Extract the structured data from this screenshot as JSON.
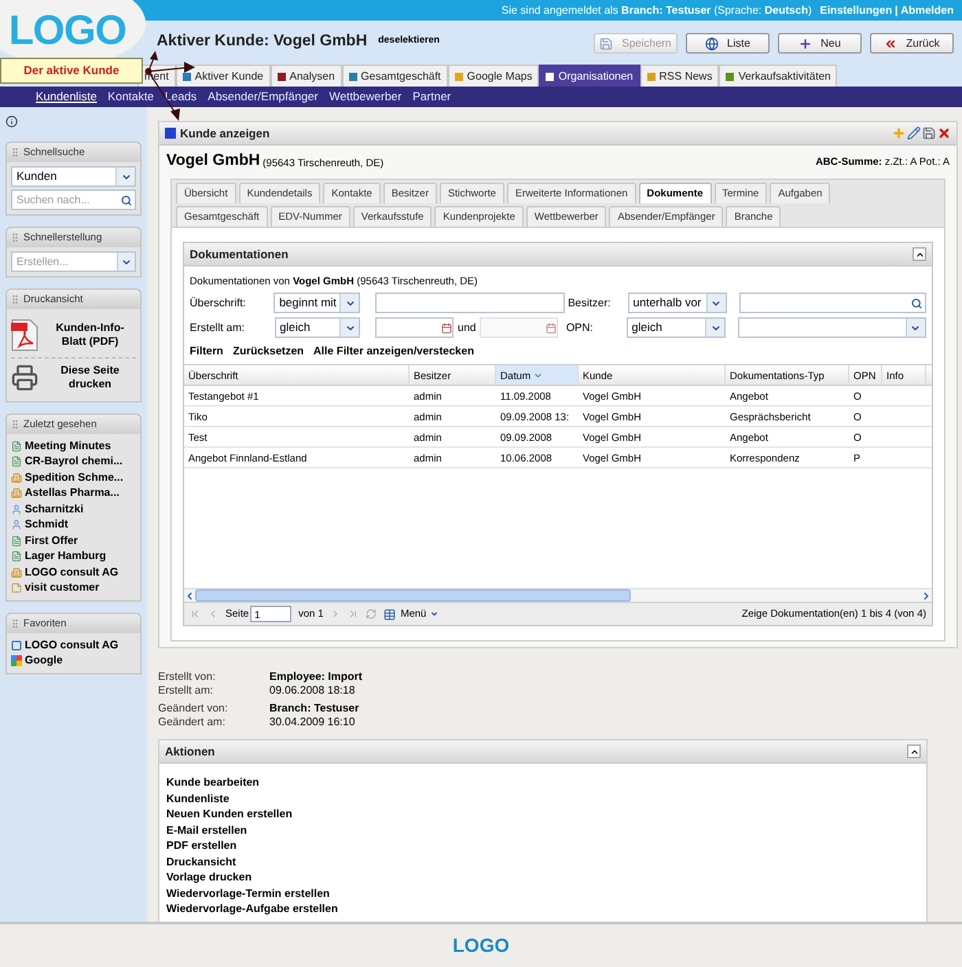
{
  "top_bar": {
    "login": "Sie sind angemeldet als **Branch: Testuser** (Sprache: **Deutsch**)",
    "links": [
      "Einstellungen",
      "Abmelden"
    ],
    "link_separator": "|"
  },
  "logo": "LOGO",
  "active_customer": {
    "title": "Aktiver Kunde: Vogel GmbH",
    "deselect": "deselektieren"
  },
  "toolbar_buttons": [
    {
      "label": "Speichern",
      "kind": "save",
      "disabled": true
    },
    {
      "label": "Liste",
      "kind": "list",
      "disabled": false
    },
    {
      "label": "Neu",
      "kind": "new",
      "disabled": false
    },
    {
      "label": "Zurück",
      "kind": "back",
      "disabled": false
    }
  ],
  "callout": {
    "text": "Der aktive Kunde"
  },
  "main_tabs": [
    {
      "label": "ment",
      "selected": false
    },
    {
      "label": "Aktiver Kunde",
      "color": "#2e7cb8",
      "selected": false
    },
    {
      "label": "Analysen",
      "color": "#8c1c24",
      "selected": false
    },
    {
      "label": "Gesamtgeschäft",
      "color": "#2a7fa8",
      "selected": false
    },
    {
      "label": "Google Maps",
      "color": "#e0a81c",
      "selected": false
    },
    {
      "label": "Organisationen",
      "color": "#ffffff",
      "selected": true
    },
    {
      "label": "RSS News",
      "color": "#d9a21a",
      "selected": false
    },
    {
      "label": "Verkaufsaktivitäten",
      "color": "#5f8f1e",
      "selected": false
    }
  ],
  "sub_nav": [
    {
      "label": "Kundenliste",
      "selected": true
    },
    {
      "label": "Kontakte",
      "selected": false
    },
    {
      "label": "Leads",
      "selected": false
    },
    {
      "label": "Absender/Empfänger",
      "selected": false
    },
    {
      "label": "Wettbewerber",
      "selected": false
    },
    {
      "label": "Partner",
      "selected": false
    }
  ],
  "sidebar": {
    "quick_search": {
      "title": "Schnellsuche",
      "type_value": "Kunden",
      "placeholder": "Suchen nach..."
    },
    "quick_create": {
      "title": "Schnellerstellung",
      "placeholder": "Erstellen..."
    },
    "print_view": {
      "title": "Druckansicht",
      "items": [
        {
          "label": "Kunden-Info-Blatt (PDF)",
          "kind": "pdf"
        },
        {
          "label": "Diese Seite drucken",
          "kind": "print"
        }
      ]
    },
    "recent": {
      "title": "Zuletzt gesehen",
      "items": [
        {
          "label": "Meeting Minutes",
          "kind": "document"
        },
        {
          "label": "CR-Bayrol chemi...",
          "kind": "document"
        },
        {
          "label": "Spedition Schme...",
          "kind": "organisation"
        },
        {
          "label": "Astellas Pharma...",
          "kind": "organisation"
        },
        {
          "label": "Scharnitzki",
          "kind": "person"
        },
        {
          "label": "Schmidt",
          "kind": "person"
        },
        {
          "label": "First Offer",
          "kind": "document"
        },
        {
          "label": "Lager Hamburg",
          "kind": "document"
        },
        {
          "label": "LOGO consult AG",
          "kind": "organisation"
        },
        {
          "label": "visit customer",
          "kind": "note"
        }
      ]
    },
    "favorites": {
      "title": "Favoriten",
      "items": [
        {
          "label": "LOGO consult AG",
          "kind": "link"
        },
        {
          "label": "Google",
          "kind": "web"
        }
      ]
    }
  },
  "customer_panel": {
    "title": "Kunde anzeigen",
    "name": "Vogel GmbH",
    "location": "(95643 Tirschenreuth, DE)",
    "abc": "**ABC-Summe:** z.Zt.: A Pot.: A",
    "tab_rows": [
      [
        {
          "label": "Übersicht",
          "selected": false
        },
        {
          "label": "Kundendetails",
          "selected": false
        },
        {
          "label": "Kontakte",
          "selected": false
        },
        {
          "label": "Besitzer",
          "selected": false
        },
        {
          "label": "Stichworte",
          "selected": false
        },
        {
          "label": "Erweiterte Informationen",
          "selected": false
        },
        {
          "label": "Dokumente",
          "selected": true
        },
        {
          "label": "Termine",
          "selected": false
        },
        {
          "label": "Aufgaben",
          "selected": false
        }
      ],
      [
        {
          "label": "Gesamtgeschäft",
          "selected": false
        },
        {
          "label": "EDV-Nummer",
          "selected": false
        },
        {
          "label": "Verkaufsstufe",
          "selected": false
        },
        {
          "label": "Kundenprojekte",
          "selected": false
        },
        {
          "label": "Wettbewerber",
          "selected": false
        },
        {
          "label": "Absender/Empfänger",
          "selected": false
        },
        {
          "label": "Branche",
          "selected": false
        }
      ]
    ]
  },
  "documents": {
    "title": "Dokumentationen",
    "subtitle": "Dokumentationen von **Vogel GmbH** (95643 Tirschenreuth, DE)",
    "filters": [
      {
        "label": "Überschrift:",
        "operator": "beginnt mit",
        "kind": "text"
      },
      {
        "label": "Besitzer:",
        "operator": "unterhalb vor",
        "kind": "search"
      },
      {
        "label": "Erstellt am:",
        "operator": "gleich",
        "kind": "date_range",
        "between": "und"
      },
      {
        "label": "OPN:",
        "operator": "gleich",
        "kind": "select"
      }
    ],
    "actions": [
      "Filtern",
      "Zurücksetzen",
      "Alle Filter anzeigen/verstecken"
    ],
    "table": {
      "columns": [
        {
          "label": "Überschrift",
          "sorted": false
        },
        {
          "label": "Besitzer",
          "sorted": false
        },
        {
          "label": "Datum",
          "sorted": true
        },
        {
          "label": "Kunde",
          "sorted": false
        },
        {
          "label": "Dokumentations-Typ",
          "sorted": false
        },
        {
          "label": "OPN",
          "sorted": false
        },
        {
          "label": "Info",
          "sorted": false
        }
      ],
      "rows": [
        [
          "Testangebot #1",
          "admin",
          "11.09.2008",
          "Vogel GmbH",
          "Angebot",
          "O"
        ],
        [
          "Tiko",
          "admin",
          "09.09.2008 13:",
          "Vogel GmbH",
          "Gesprächsbericht",
          "O"
        ],
        [
          "Test",
          "admin",
          "09.09.2008",
          "Vogel GmbH",
          "Angebot",
          "O"
        ],
        [
          "Angebot Finnland-Estland",
          "admin",
          "10.06.2008",
          "Vogel GmbH",
          "Korrespondenz",
          "P"
        ]
      ]
    },
    "pager": {
      "page_label": "Seite",
      "page": "1",
      "of": "von 1",
      "menu": "Menü",
      "summary": "Zeige Dokumentation(en) 1 bis 4 (von 4)"
    }
  },
  "meta": [
    {
      "label": "Erstellt von:",
      "value": "Employee: Import",
      "emphasis": true
    },
    {
      "label": "Erstellt am:",
      "value": "09.06.2008 18:18",
      "emphasis": false
    },
    {
      "label": "Geändert von:",
      "value": "Branch: Testuser",
      "emphasis": true
    },
    {
      "label": "Geändert am:",
      "value": "30.04.2009 16:10",
      "emphasis": false
    }
  ],
  "actions_panel": {
    "title": "Aktionen",
    "items": [
      "Kunde bearbeiten",
      "Kundenliste",
      "Neuen Kunden erstellen",
      "E-Mail erstellen",
      "PDF erstellen",
      "Druckansicht",
      "Vorlage drucken",
      "Wiedervorlage-Termin erstellen",
      "Wiedervorlage-Aufgabe erstellen"
    ]
  },
  "footer": {
    "logo": "LOGO"
  }
}
